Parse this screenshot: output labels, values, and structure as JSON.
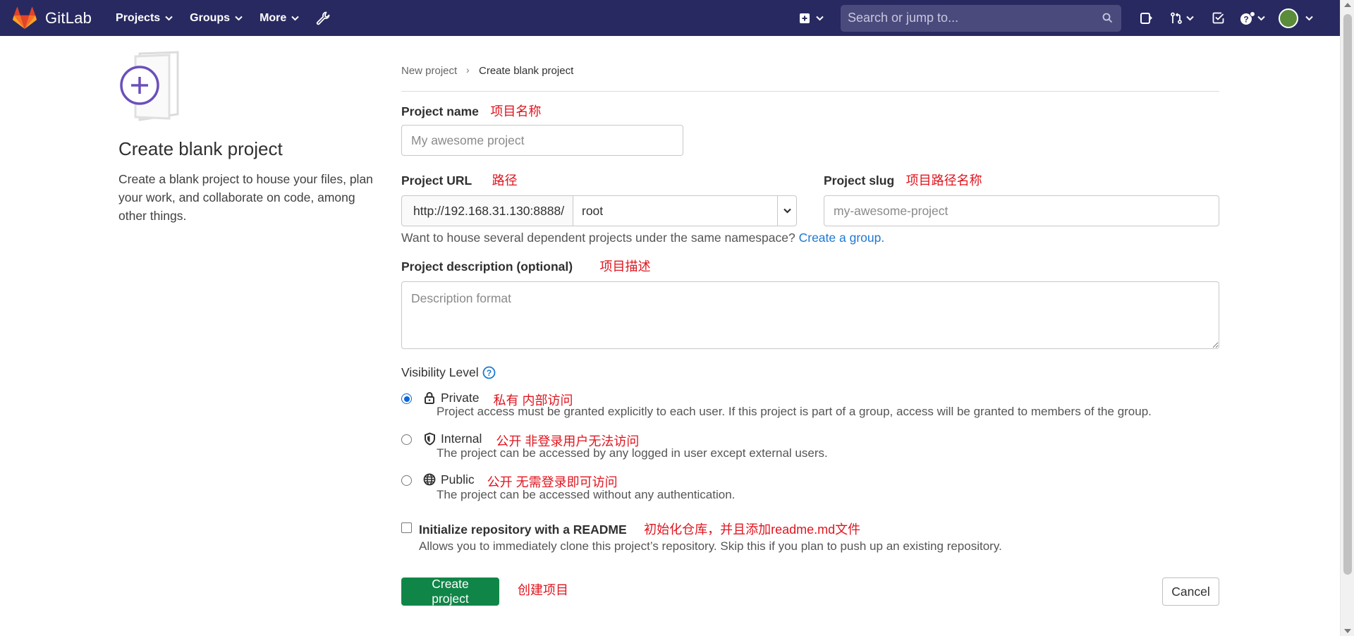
{
  "navbar": {
    "brand": "GitLab",
    "projects_label": "Projects",
    "groups_label": "Groups",
    "more_label": "More",
    "search_placeholder": "Search or jump to...",
    "bg_color": "#292961"
  },
  "breadcrumb": {
    "parent": "New project",
    "current": "Create blank project"
  },
  "left_panel": {
    "title": "Create blank project",
    "description": "Create a blank project to house your files, plan your work, and collaborate on code, among other things."
  },
  "form": {
    "project_name": {
      "label": "Project name",
      "annotation": "项目名称",
      "placeholder": "My awesome project",
      "value": ""
    },
    "project_url": {
      "label": "Project URL",
      "annotation": "路径",
      "prefix": "http://192.168.31.130:8888/",
      "namespace": "root"
    },
    "project_slug": {
      "label": "Project slug",
      "annotation": "项目路径名称",
      "placeholder": "my-awesome-project"
    },
    "namespace_hint": {
      "text": "Want to house several dependent projects under the same namespace?",
      "link": "Create a group."
    },
    "description": {
      "label": "Project description (optional)",
      "annotation": "项目描述",
      "placeholder": "Description format"
    },
    "visibility": {
      "label": "Visibility Level",
      "options": [
        {
          "label": "Private",
          "annotation": "私有 内部访问",
          "description": "Project access must be granted explicitly to each user. If this project is part of a group, access will be granted to members of the group.",
          "icon": "lock-icon",
          "checked": true
        },
        {
          "label": "Internal",
          "annotation": "公开 非登录用户无法访问",
          "description": "The project can be accessed by any logged in user except external users.",
          "icon": "shield-icon",
          "checked": false
        },
        {
          "label": "Public",
          "annotation": "公开 无需登录即可访问",
          "description": "The project can be accessed without any authentication.",
          "icon": "globe-icon",
          "checked": false
        }
      ]
    },
    "readme": {
      "label": "Initialize repository with a README",
      "annotation": "初始化仓库，并且添加readme.md文件",
      "description": "Allows you to immediately clone this project’s repository. Skip this if you plan to push up an existing repository.",
      "checked": false
    },
    "create_button": "Create project",
    "create_annotation": "创建项目",
    "cancel_button": "Cancel"
  },
  "colors": {
    "accent_link": "#1f78d1",
    "create_button": "#108548",
    "annotation_red": "#e0141e",
    "radio_checked": "#0a66d8"
  }
}
